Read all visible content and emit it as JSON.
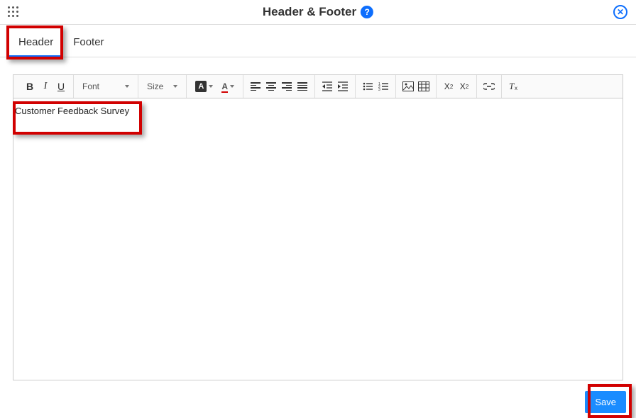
{
  "header": {
    "title": "Header & Footer"
  },
  "tabs": {
    "header": "Header",
    "footer": "Footer"
  },
  "toolbar": {
    "font_label": "Font",
    "size_label": "Size"
  },
  "editor": {
    "content": "Customer Feedback Survey"
  },
  "buttons": {
    "save": "Save"
  }
}
